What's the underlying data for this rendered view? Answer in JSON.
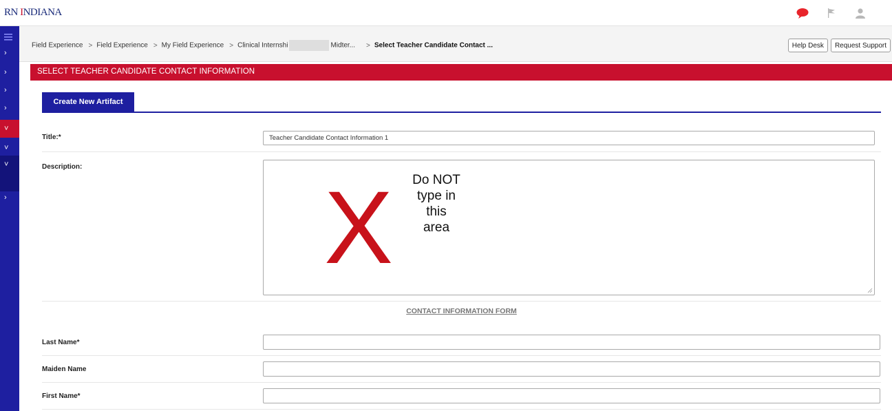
{
  "topbar": {
    "logo_prefix": "RN ",
    "logo_accent": "I",
    "logo_suffix": "NDIANA",
    "icons": [
      "chat-bubble-icon",
      "flag-icon",
      "user-icon"
    ],
    "colors": {
      "chat": "#e8242b",
      "muted": "#b8b8b8"
    }
  },
  "breadcrumb": {
    "items": [
      "Field Experience",
      "Field Experience",
      "My Field Experience",
      "Clinical Internshi",
      "Midter...",
      "Select Teacher Candidate Contact ..."
    ],
    "separator": ">"
  },
  "actions": {
    "help_desk": "Help Desk",
    "request_support": "Request Support"
  },
  "page": {
    "header": "SELECT TEACHER CANDIDATE CONTACT INFORMATION",
    "tab_label": "Create New Artifact"
  },
  "form": {
    "title_label": "Title:*",
    "title_value": "Teacher Candidate Contact Information 1",
    "description_label": "Description:",
    "annotation_mark": "X",
    "annotation_text": "Do NOT type in this area",
    "section_title": "CONTACT INFORMATION FORM",
    "last_name_label": "Last Name*",
    "maiden_name_label": "Maiden Name",
    "first_name_label": "First Name*"
  },
  "colors": {
    "brand_blue": "#1e1fa0",
    "brand_red": "#c8102e"
  }
}
